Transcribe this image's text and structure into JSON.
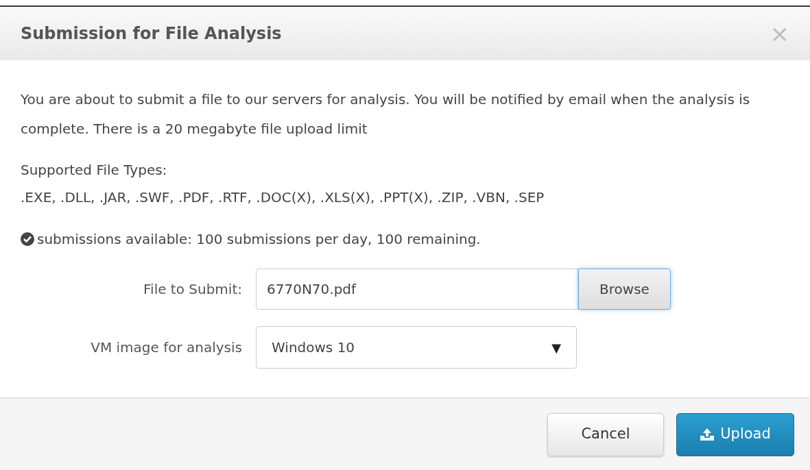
{
  "dialog": {
    "title": "Submission for File Analysis",
    "close": "×"
  },
  "intro": "You are about to submit a file to our servers for analysis. You will be notified by email when the analysis is complete. There is a 20 megabyte file upload limit",
  "supported_label": "Supported File Types:",
  "supported_types": ".EXE, .DLL, .JAR, .SWF, .PDF, .RTF, .DOC(X), .XLS(X), .PPT(X), .ZIP, .VBN, .SEP",
  "quota": "submissions available: 100 submissions per day, 100 remaining.",
  "form": {
    "file_label": "File to Submit:",
    "file_value": "6770N70.pdf",
    "browse": "Browse",
    "vm_label": "VM image for analysis",
    "vm_value": "Windows 10",
    "vm_caret": "▼"
  },
  "buttons": [
    {
      "label": "Cancel",
      "kind": "default"
    },
    {
      "label": "Upload",
      "kind": "primary"
    }
  ]
}
